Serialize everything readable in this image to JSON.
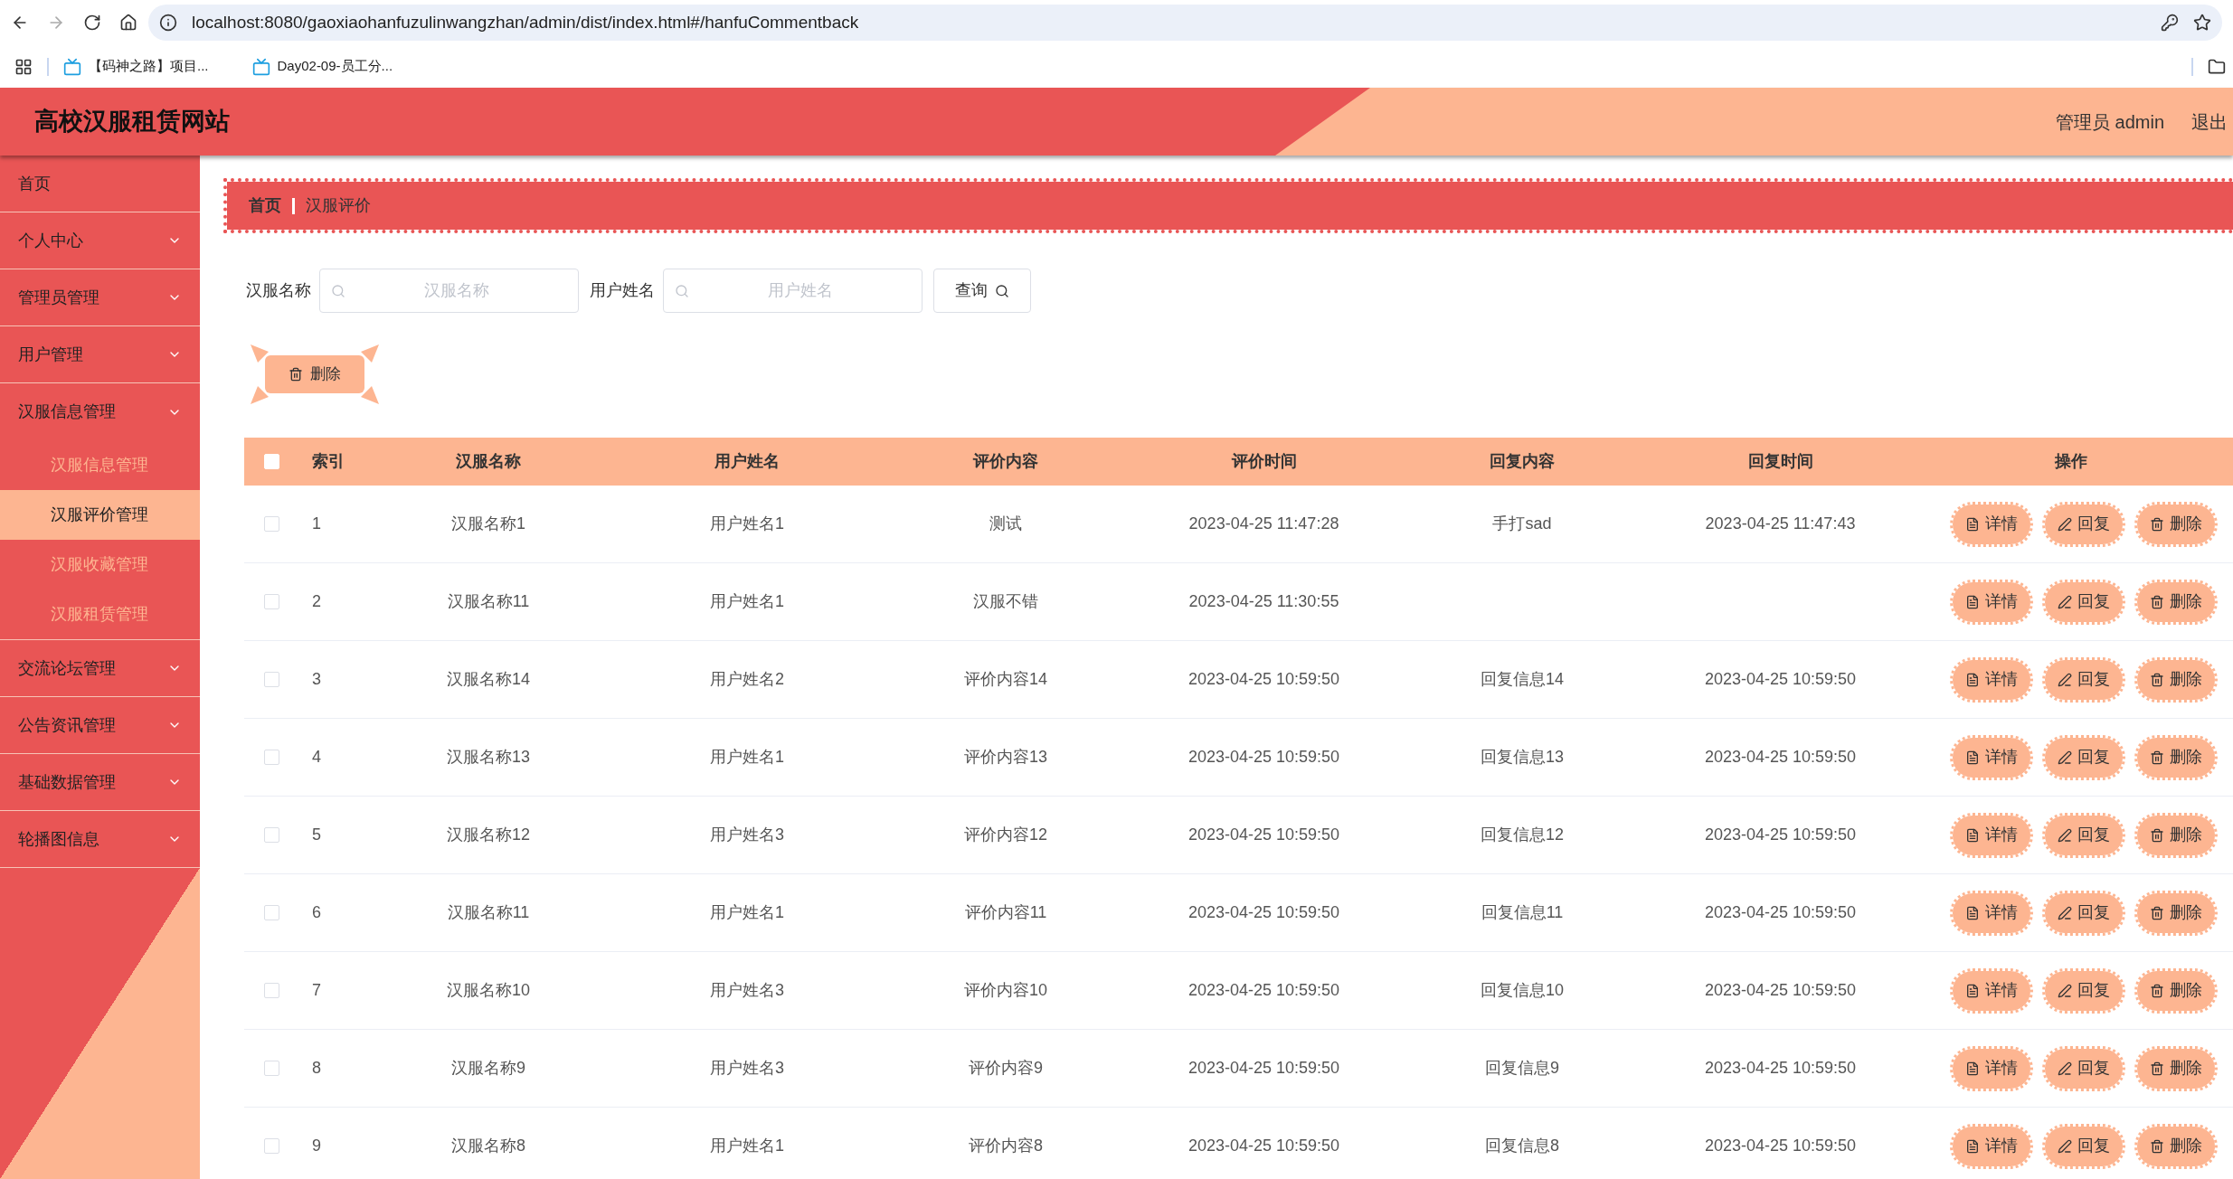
{
  "browser": {
    "url": "localhost:8080/gaoxiaohanfuzulinwangzhan/admin/dist/index.html#/hanfuCommentback",
    "bookmarks": [
      "【码神之路】项目...",
      "Day02-09-员工分..."
    ]
  },
  "header": {
    "title": "高校汉服租赁网站",
    "user": "管理员 admin",
    "logout": "退出"
  },
  "sidebar": {
    "items": [
      {
        "kind": "link",
        "label": "首页",
        "selected": false
      },
      {
        "kind": "group",
        "label": "个人中心",
        "selected": false
      },
      {
        "kind": "group",
        "label": "管理员管理",
        "selected": false
      },
      {
        "kind": "group",
        "label": "用户管理",
        "selected": false
      },
      {
        "kind": "group",
        "label": "汉服信息管理",
        "expanded": true,
        "selected": false,
        "children": [
          {
            "label": "汉服信息管理",
            "selected": false
          },
          {
            "label": "汉服评价管理",
            "selected": true
          },
          {
            "label": "汉服收藏管理",
            "selected": false
          },
          {
            "label": "汉服租赁管理",
            "selected": false
          }
        ]
      },
      {
        "kind": "group",
        "label": "交流论坛管理",
        "selected": false
      },
      {
        "kind": "group",
        "label": "公告资讯管理",
        "selected": false
      },
      {
        "kind": "group",
        "label": "基础数据管理",
        "selected": false
      },
      {
        "kind": "group",
        "label": "轮播图信息",
        "selected": false
      }
    ]
  },
  "breadcrumb": [
    "首页",
    "汉服评价"
  ],
  "search": {
    "fields": [
      {
        "label": "汉服名称",
        "placeholder": "汉服名称"
      },
      {
        "label": "用户姓名",
        "placeholder": "用户姓名"
      }
    ],
    "button": "查询"
  },
  "toolbar": {
    "delete_button": "删除"
  },
  "table": {
    "all_checked": false,
    "columns": [
      "索引",
      "汉服名称",
      "用户姓名",
      "评价内容",
      "评价时间",
      "回复内容",
      "回复时间",
      "操作"
    ],
    "rows": [
      {
        "checked": false,
        "cells": [
          "1",
          "汉服名称1",
          "用户姓名1",
          "测试",
          "2023-04-25 11:47:28",
          "手打sad",
          "2023-04-25 11:47:43"
        ],
        "actions": [
          {
            "kind": "detail",
            "label": "详情"
          },
          {
            "kind": "reply",
            "label": "回复"
          },
          {
            "kind": "delete",
            "label": "删除"
          }
        ]
      },
      {
        "checked": false,
        "cells": [
          "2",
          "汉服名称11",
          "用户姓名1",
          "汉服不错",
          "2023-04-25 11:30:55",
          null,
          null
        ],
        "actions": [
          {
            "kind": "detail",
            "label": "详情"
          },
          {
            "kind": "reply",
            "label": "回复"
          },
          {
            "kind": "delete",
            "label": "删除"
          }
        ]
      },
      {
        "checked": false,
        "cells": [
          "3",
          "汉服名称14",
          "用户姓名2",
          "评价内容14",
          "2023-04-25 10:59:50",
          "回复信息14",
          "2023-04-25 10:59:50"
        ],
        "actions": [
          {
            "kind": "detail",
            "label": "详情"
          },
          {
            "kind": "reply",
            "label": "回复"
          },
          {
            "kind": "delete",
            "label": "删除"
          }
        ]
      },
      {
        "checked": false,
        "cells": [
          "4",
          "汉服名称13",
          "用户姓名1",
          "评价内容13",
          "2023-04-25 10:59:50",
          "回复信息13",
          "2023-04-25 10:59:50"
        ],
        "actions": [
          {
            "kind": "detail",
            "label": "详情"
          },
          {
            "kind": "reply",
            "label": "回复"
          },
          {
            "kind": "delete",
            "label": "删除"
          }
        ]
      },
      {
        "checked": false,
        "cells": [
          "5",
          "汉服名称12",
          "用户姓名3",
          "评价内容12",
          "2023-04-25 10:59:50",
          "回复信息12",
          "2023-04-25 10:59:50"
        ],
        "actions": [
          {
            "kind": "detail",
            "label": "详情"
          },
          {
            "kind": "reply",
            "label": "回复"
          },
          {
            "kind": "delete",
            "label": "删除"
          }
        ]
      },
      {
        "checked": false,
        "cells": [
          "6",
          "汉服名称11",
          "用户姓名1",
          "评价内容11",
          "2023-04-25 10:59:50",
          "回复信息11",
          "2023-04-25 10:59:50"
        ],
        "actions": [
          {
            "kind": "detail",
            "label": "详情"
          },
          {
            "kind": "reply",
            "label": "回复"
          },
          {
            "kind": "delete",
            "label": "删除"
          }
        ]
      },
      {
        "checked": false,
        "cells": [
          "7",
          "汉服名称10",
          "用户姓名3",
          "评价内容10",
          "2023-04-25 10:59:50",
          "回复信息10",
          "2023-04-25 10:59:50"
        ],
        "actions": [
          {
            "kind": "detail",
            "label": "详情"
          },
          {
            "kind": "reply",
            "label": "回复"
          },
          {
            "kind": "delete",
            "label": "删除"
          }
        ]
      },
      {
        "checked": false,
        "cells": [
          "8",
          "汉服名称9",
          "用户姓名3",
          "评价内容9",
          "2023-04-25 10:59:50",
          "回复信息9",
          "2023-04-25 10:59:50"
        ],
        "actions": [
          {
            "kind": "detail",
            "label": "详情"
          },
          {
            "kind": "reply",
            "label": "回复"
          },
          {
            "kind": "delete",
            "label": "删除"
          }
        ]
      },
      {
        "checked": false,
        "cells": [
          "9",
          "汉服名称8",
          "用户姓名1",
          "评价内容8",
          "2023-04-25 10:59:50",
          "回复信息8",
          "2023-04-25 10:59:50"
        ],
        "actions": [
          {
            "kind": "detail",
            "label": "详情"
          },
          {
            "kind": "reply",
            "label": "回复"
          },
          {
            "kind": "delete",
            "label": "删除"
          }
        ]
      }
    ]
  }
}
